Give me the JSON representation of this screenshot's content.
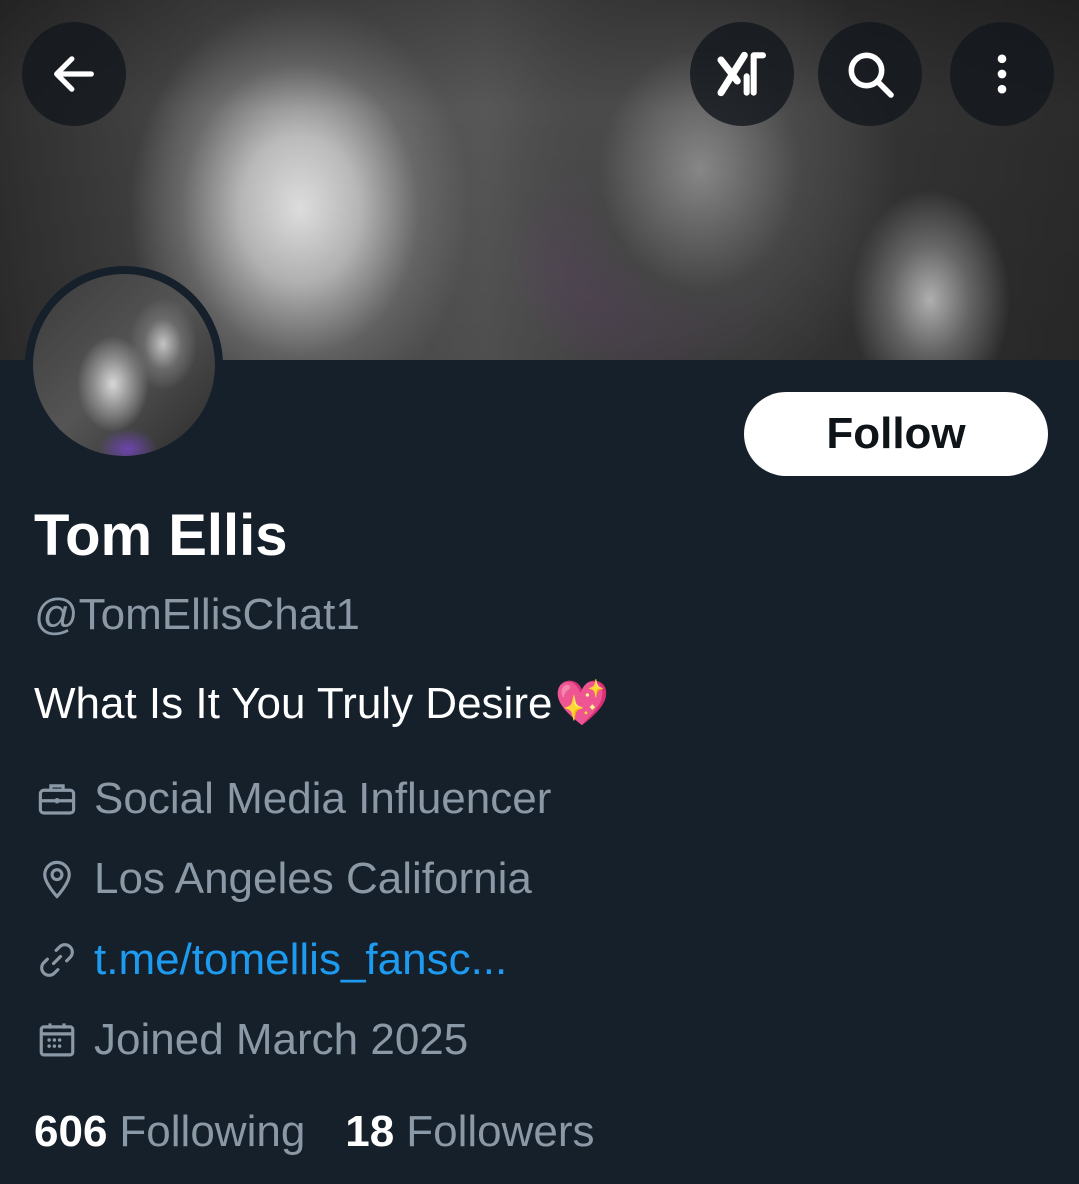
{
  "header": {
    "back_icon": "arrow-left-icon",
    "grok_icon": "grok-icon",
    "search_icon": "search-icon",
    "more_icon": "more-vertical-icon"
  },
  "profile": {
    "name": "Tom Ellis",
    "handle": "@TomEllisChat1",
    "bio": "What Is It You Truly Desire",
    "bio_emoji": "💖",
    "follow_label": "Follow",
    "category": "Social Media Influencer",
    "location": "Los Angeles California",
    "link": "t.me/tomellis_fansc...",
    "joined": "Joined March 2025",
    "following_count": "606",
    "following_label": "Following",
    "followers_count": "18",
    "followers_label": "Followers"
  },
  "colors": {
    "background": "#15202b",
    "muted_text": "#8b98a5",
    "link": "#1d9bf0",
    "button_bg": "#ffffff"
  }
}
